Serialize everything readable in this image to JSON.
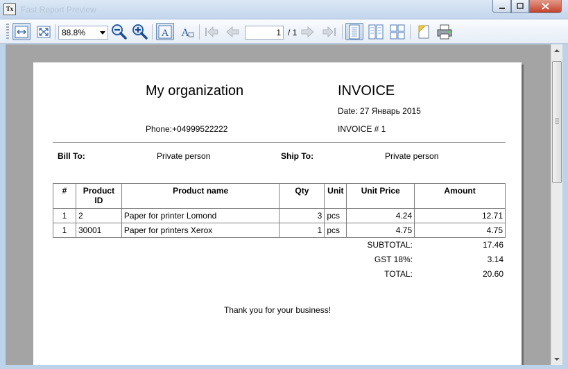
{
  "window": {
    "app_icon": "Tx",
    "title": "Fast Report Preview"
  },
  "toolbar": {
    "zoom_value": "88.8%",
    "page_current": "1",
    "page_total": "/ 1",
    "icons": [
      "page-width-icon",
      "whole-page-icon",
      "zoom-out-icon",
      "zoom-in-icon",
      "text-select-icon",
      "text-tool-icon",
      "first-page-icon",
      "prev-page-icon",
      "next-page-icon",
      "last-page-icon",
      "single-page-icon",
      "two-pages-icon",
      "four-pages-icon",
      "page-setup-icon",
      "print-icon"
    ]
  },
  "invoice": {
    "org_name": "My organization",
    "title": "INVOICE",
    "date": "Date: 27 Январь 2015",
    "phone": "Phone:+04999522222",
    "number": "INVOICE # 1",
    "bill_to_label": "Bill To:",
    "bill_to_value": "Private person",
    "ship_to_label": "Ship To:",
    "ship_to_value": "Private person",
    "columns": {
      "num": "#",
      "product_id": "Product ID",
      "product_name": "Product name",
      "qty": "Qty",
      "unit": "Unit",
      "unit_price": "Unit Price",
      "amount": "Amount"
    },
    "rows": [
      {
        "num": "1",
        "product_id": "2",
        "product_name": "Paper for printer Lomond",
        "qty": "3",
        "unit": "pcs",
        "unit_price": "4.24",
        "amount": "12.71"
      },
      {
        "num": "1",
        "product_id": "30001",
        "product_name": "Paper for printers Xerox",
        "qty": "1",
        "unit": "pcs",
        "unit_price": "4.75",
        "amount": "4.75"
      }
    ],
    "subtotal_label": "SUBTOTAL:",
    "subtotal_value": "17.46",
    "gst_label": "GST 18%:",
    "gst_value": "3.14",
    "total_label": "TOTAL:",
    "total_value": "20.60",
    "thanks": "Thank you for your business!"
  }
}
